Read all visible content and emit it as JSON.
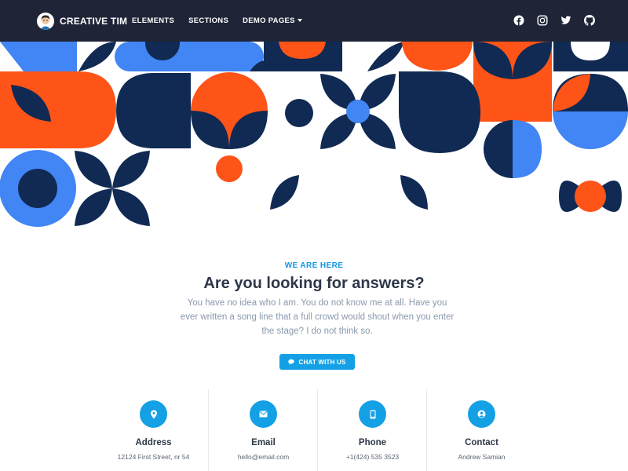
{
  "navbar": {
    "brand": "CREATIVE TIM",
    "links": [
      {
        "label": "ELEMENTS"
      },
      {
        "label": "SECTIONS"
      },
      {
        "label": "DEMO PAGES"
      }
    ],
    "social": [
      "facebook-icon",
      "instagram-icon",
      "twitter-icon",
      "github-icon"
    ]
  },
  "main": {
    "eyebrow": "WE ARE HERE",
    "title": "Are you looking for answers?",
    "description": "You have no idea who I am. You do not know me at all. Have you ever written a song line that a full crowd would shout when you enter the stage? I do not think so.",
    "cta_label": "CHAT WITH US"
  },
  "contacts": [
    {
      "icon": "location-pin-icon",
      "title": "Address",
      "value": "12124 First Street, nr 54"
    },
    {
      "icon": "envelope-icon",
      "title": "Email",
      "value": "hello@email.com"
    },
    {
      "icon": "phone-icon",
      "title": "Phone",
      "value": "+1(424) 535 3523"
    },
    {
      "icon": "user-circle-icon",
      "title": "Contact",
      "value": "Andrew Samian"
    }
  ],
  "colors": {
    "navbar": "#1f2537",
    "accent": "#14a0e5",
    "navy": "#102a53",
    "orange": "#ff5418",
    "blue": "#4285f4",
    "heading": "#2d3748",
    "muted": "#8a98ad"
  }
}
